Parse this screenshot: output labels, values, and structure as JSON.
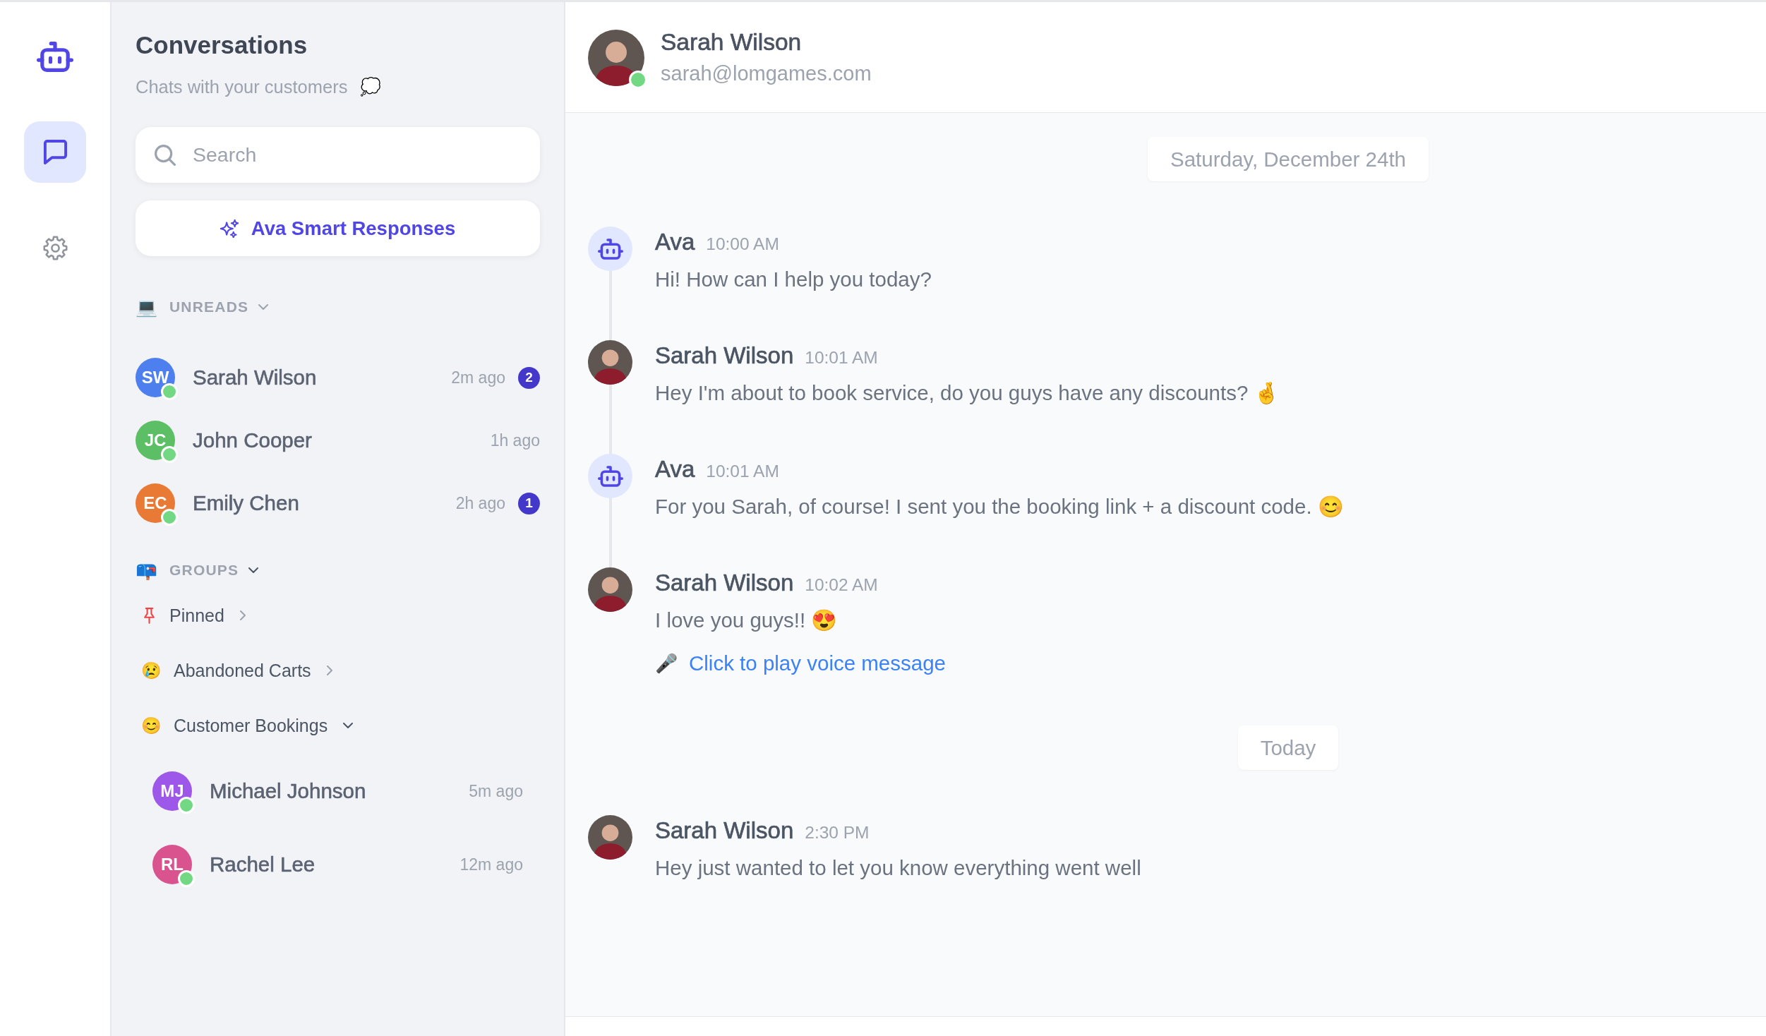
{
  "nav": [
    {
      "kind": "chats",
      "selected": true
    },
    {
      "kind": "settings",
      "selected": false
    }
  ],
  "sidebar": {
    "title": "Conversations",
    "subtitle": "Chats with your customers",
    "subtitle_emoji": "💭",
    "search": {
      "placeholder": "Search"
    },
    "smart_button": {
      "label": "Ava Smart Responses"
    },
    "unreads": {
      "emoji": "💻",
      "label": "UNREADS",
      "expanded": true,
      "conversations": [
        {
          "initials": "SW",
          "name": "Sarah Wilson",
          "time": "2m ago",
          "unread": "2",
          "color": "#4d80ee",
          "online": true
        },
        {
          "initials": "JC",
          "name": "John Cooper",
          "time": "1h ago",
          "color": "#5cbf65",
          "online": true
        },
        {
          "initials": "EC",
          "name": "Emily Chen",
          "time": "2h ago",
          "unread": "1",
          "color": "#e87a35",
          "online": true
        }
      ]
    },
    "groups": {
      "emoji": "📪",
      "label": "GROUPS",
      "expanded": true,
      "items": [
        {
          "kind": "pin",
          "label": "Pinned",
          "expanded": false
        },
        {
          "kind": "emoji",
          "emoji": "😢",
          "label": "Abandoned Carts",
          "expanded": false
        },
        {
          "kind": "emoji",
          "emoji": "😊",
          "label": "Customer Bookings",
          "expanded": true,
          "conversations": [
            {
              "initials": "MJ",
              "name": "Michael Johnson",
              "time": "5m ago",
              "color": "#9d58ea",
              "online": true
            },
            {
              "initials": "RL",
              "name": "Rachel Lee",
              "time": "12m ago",
              "color": "#d9538f",
              "online": true
            }
          ]
        }
      ]
    }
  },
  "chat": {
    "header": {
      "name": "Sarah Wilson",
      "email": "sarah@lomgames.com",
      "online": true
    },
    "days": [
      {
        "date": "Saturday, December 24th",
        "messages": [
          {
            "kind": "bot",
            "sender": "Ava",
            "time": "10:00 AM",
            "text": "Hi! How can I help you today?"
          },
          {
            "kind": "customer",
            "sender": "Sarah Wilson",
            "time": "10:01 AM",
            "text": "Hey I'm about to book service, do you guys have any discounts? 🤞"
          },
          {
            "kind": "bot",
            "sender": "Ava",
            "time": "10:01 AM",
            "text": "For you Sarah, of course! I sent you the booking link + a discount code. 😊"
          },
          {
            "kind": "customer",
            "sender": "Sarah Wilson",
            "time": "10:02 AM",
            "text": "I love you guys!! 😍",
            "voice": {
              "emoji": "🎤",
              "label": "Click to play voice message"
            }
          }
        ]
      },
      {
        "date": "Today",
        "messages": [
          {
            "kind": "customer",
            "sender": "Sarah Wilson",
            "time": "2:30 PM",
            "text": "Hey just wanted to let you know everything went well"
          }
        ]
      }
    ]
  }
}
